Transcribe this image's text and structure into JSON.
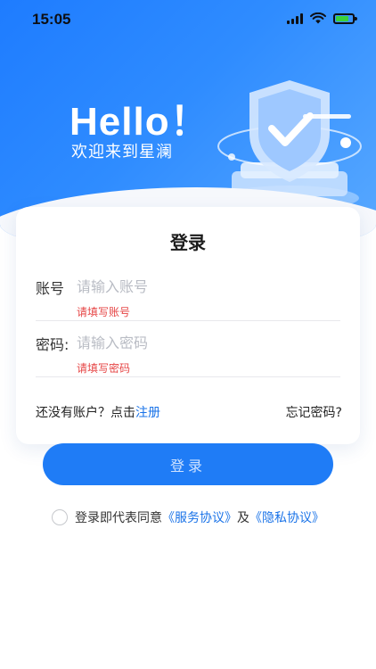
{
  "status": {
    "time": "15:05"
  },
  "hero": {
    "hello": "Hello！",
    "welcome": "欢迎来到星澜"
  },
  "card": {
    "title": "登录",
    "account": {
      "label": "账号",
      "placeholder": "请输入账号",
      "error": "请填写账号"
    },
    "password": {
      "label": "密码:",
      "placeholder": "请输入密码",
      "error": "请填写密码"
    },
    "register_prompt": "还没有账户？点击",
    "register_link": "注册",
    "forgot": "忘记密码?"
  },
  "login_button": "登录",
  "agreement": {
    "prefix": "登录即代表同意",
    "service_link": "《服务协议》",
    "and": "及",
    "privacy_link": "《隐私协议》"
  },
  "colors": {
    "primary": "#1f7cf6",
    "error": "#e64545",
    "link": "#1a73e8"
  }
}
